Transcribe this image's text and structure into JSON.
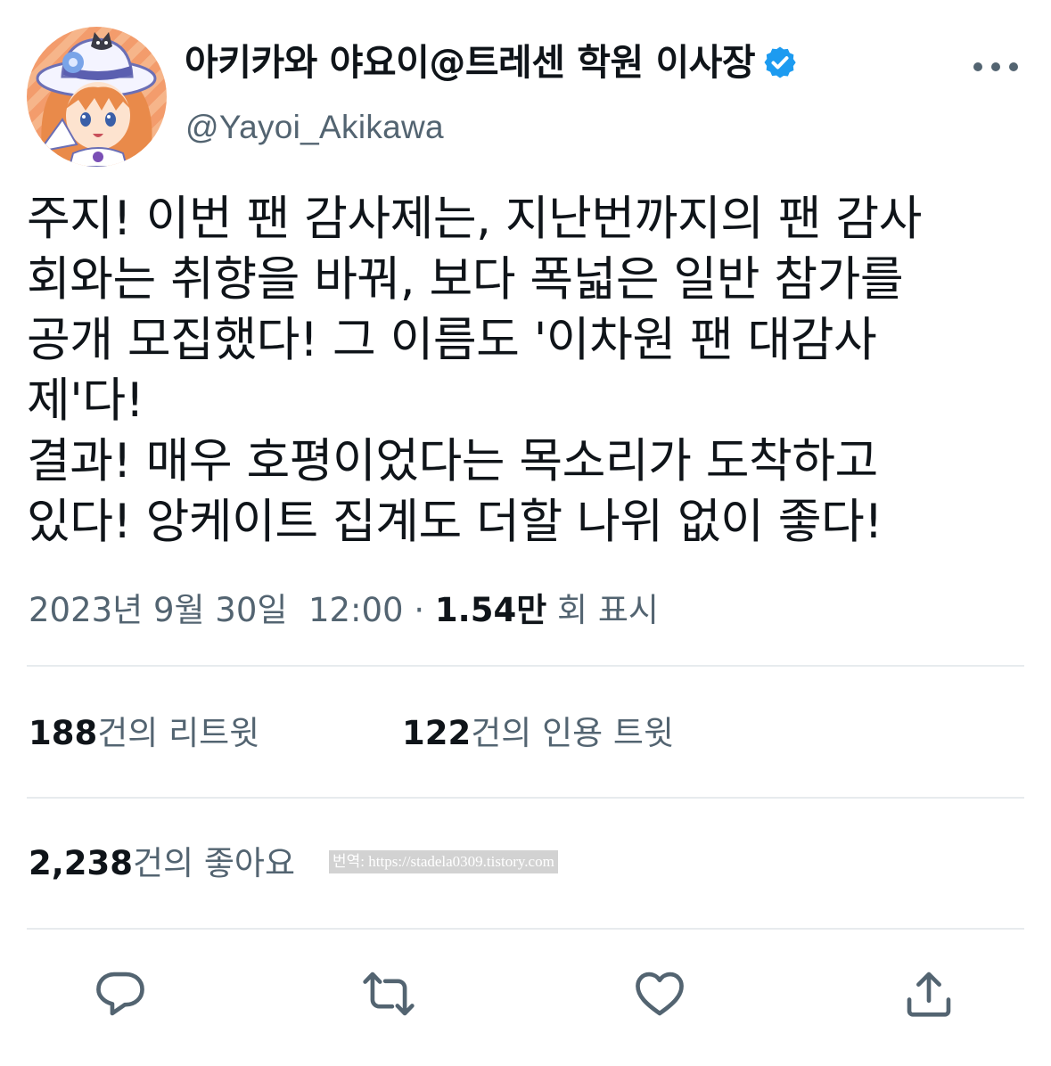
{
  "author": {
    "display_name": "아키카와 야요이@트레센 학원 이사장",
    "handle": "@Yayoi_Akikawa",
    "avatar_icon": "anime-girl-avatar",
    "verified_icon": "verified-badge-icon",
    "verified_color": "#1d9bf0"
  },
  "more_icon": "more-options-icon",
  "tweet": {
    "lines": [
      "주지! 이번 팬 감사제는, 지난번까지의 팬 감사",
      "회와는 취향을 바꿔, 보다 폭넓은 일반 참가를",
      "공개 모집했다! 그 이름도 '이차원 팬 대감사",
      "제'다!",
      "결과! 매우 호평이었다는 목소리가 도착하고",
      "있다! 앙케이트 집계도 더할 나위 없이 좋다!"
    ],
    "date": "2023년 9월 30일",
    "time": "12:00",
    "separator": "·",
    "views_count": "1.54만",
    "views_label": "회 표시"
  },
  "stats": {
    "retweets_count": "188",
    "retweets_label": "건의 리트윗",
    "quotes_count": "122",
    "quotes_label": "건의 인용 트윗",
    "likes_count": "2,238",
    "likes_label": "건의 좋아요"
  },
  "watermark": "번역: https://stadela0309.tistory.com",
  "actions": {
    "reply_icon": "reply-icon",
    "retweet_icon": "retweet-icon",
    "like_icon": "heart-icon",
    "share_icon": "share-icon",
    "icon_color": "#536471"
  },
  "colors": {
    "text": "#0f1419",
    "secondary": "#536471",
    "divider": "#e7ebee"
  }
}
